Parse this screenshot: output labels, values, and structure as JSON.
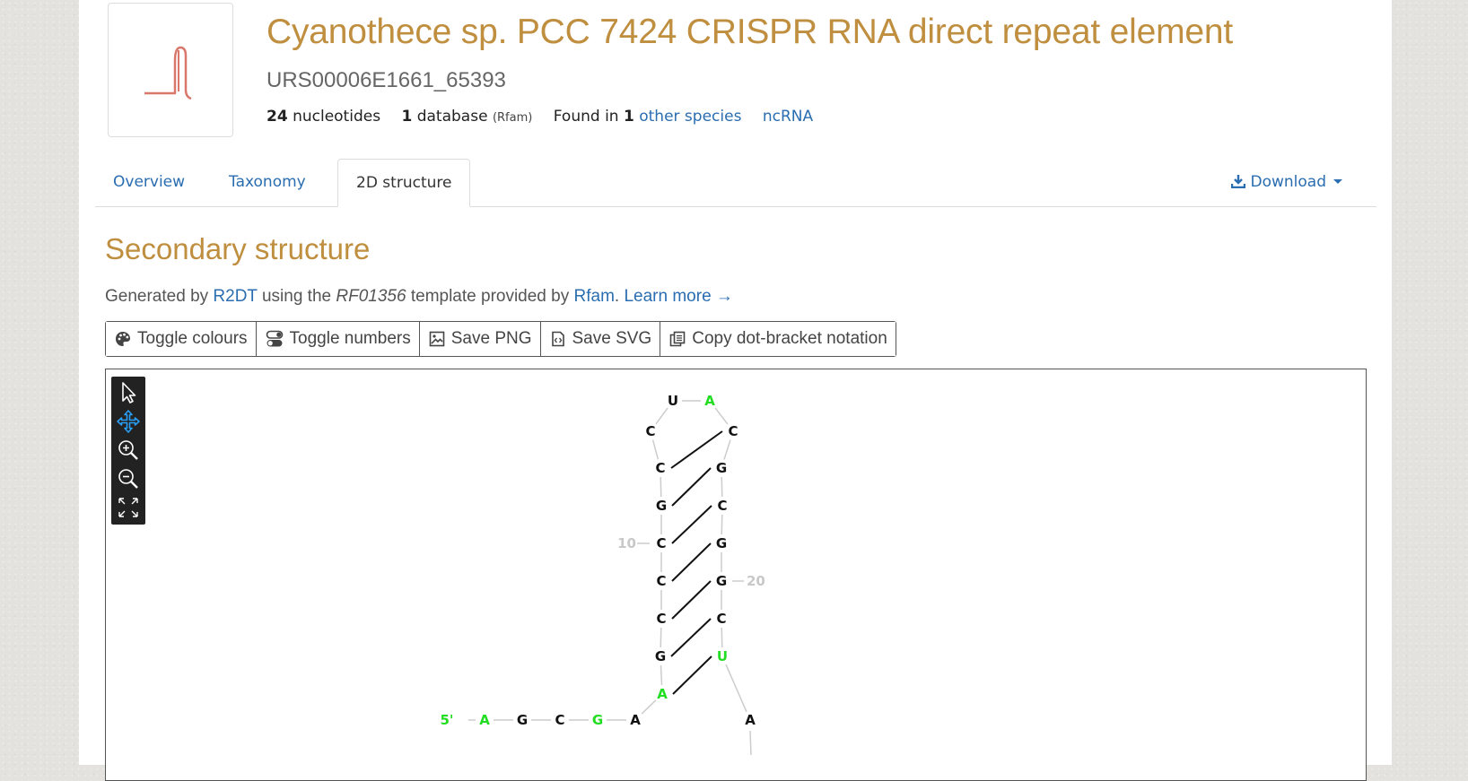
{
  "header": {
    "title": "Cyanothece sp. PCC 7424 CRISPR RNA direct repeat element",
    "urs_id": "URS00006E1661_65393",
    "meta": {
      "length_value": "24",
      "length_label": "nucleotides",
      "db_value": "1",
      "db_label": "database",
      "db_source": "(Rfam)",
      "found_prefix": "Found in",
      "found_value": "1",
      "found_link": "other species",
      "rna_type": "ncRNA"
    }
  },
  "tabs": [
    {
      "label": "Overview"
    },
    {
      "label": "Taxonomy"
    },
    {
      "label": "2D structure",
      "active": true
    }
  ],
  "download_label": "Download",
  "section": {
    "title": "Secondary structure",
    "generated_prefix": "Generated by",
    "tool_link": "R2DT",
    "using_text": "using the",
    "template_id": "RF01356",
    "template_suffix": "template provided by",
    "provider_link": "Rfam",
    "period": ".",
    "learn_more": "Learn more →"
  },
  "buttons": [
    {
      "label": "Toggle colours",
      "icon": "palette-icon"
    },
    {
      "label": "Toggle numbers",
      "icon": "toggle-icon"
    },
    {
      "label": "Save PNG",
      "icon": "image-icon"
    },
    {
      "label": "Save SVG",
      "icon": "code-file-icon"
    },
    {
      "label": "Copy dot-bracket notation",
      "icon": "copy-icon"
    }
  ],
  "viewer_tools": [
    "pointer-icon",
    "pan-icon",
    "zoom-in-icon",
    "zoom-out-icon",
    "fit-icon"
  ],
  "colors": {
    "title": "#bf8e3e",
    "link": "#2a6db0",
    "highlight_nt": "#22dd22",
    "numbers": "#c8c8c8",
    "thumbnail_stroke": "#d9776a"
  },
  "structure": {
    "five_prime_label": "5'",
    "numbers": [
      "10",
      "20"
    ],
    "nucleotides": [
      "A",
      "G",
      "C",
      "G",
      "A",
      "A",
      "G",
      "C",
      "C",
      "C",
      "G",
      "C",
      "C",
      "U",
      "A",
      "C",
      "G",
      "C",
      "G",
      "G",
      "C",
      "U",
      "A"
    ],
    "highlighted": [
      true,
      false,
      false,
      true,
      false,
      true,
      false,
      false,
      false,
      false,
      false,
      false,
      false,
      false,
      true,
      false,
      false,
      false,
      false,
      false,
      false,
      true,
      false
    ]
  }
}
